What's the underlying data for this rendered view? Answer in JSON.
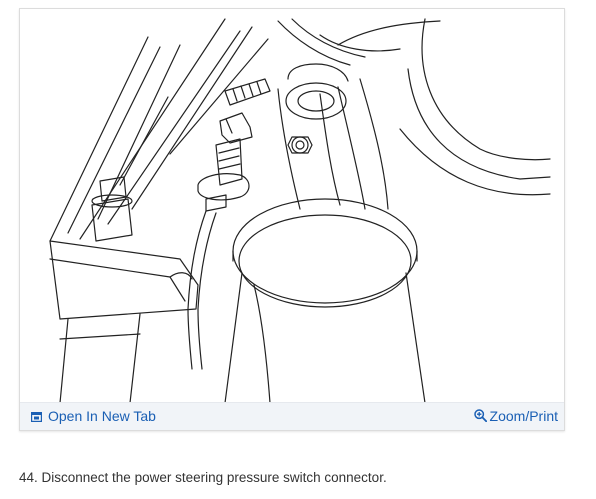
{
  "figure": {
    "open_in_new_tab_label": "Open In New Tab",
    "zoom_print_label": "Zoom/Print",
    "illustration_icon": "engine-line-drawing",
    "link_color": "#1a5fb4"
  },
  "step": {
    "text": "44. Disconnect the power steering pressure switch connector."
  }
}
